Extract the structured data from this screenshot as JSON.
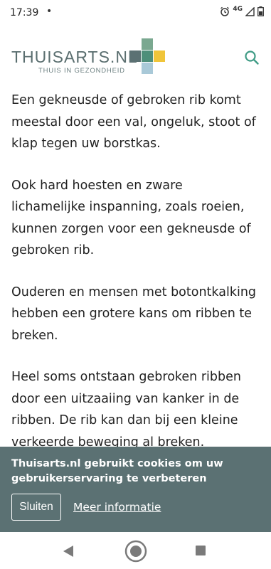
{
  "status_bar": {
    "time": "17:39",
    "dot": "•",
    "network": "4G",
    "icons": [
      "alarm-icon",
      "signal-icon",
      "battery-icon"
    ]
  },
  "header": {
    "logo_title": "THUISARTS.NL",
    "logo_subtitle": "THUIS IN GEZONDHEID",
    "search_icon": "search-icon",
    "colors": {
      "brand_text": "#5a6e6f",
      "cross_top": "#7aa890",
      "cross_left": "#5b7173",
      "cross_center": "#4e8f7a",
      "cross_right": "#f0c53a",
      "cross_bottom": "#a9c9d8",
      "search": "#3f9b85"
    }
  },
  "content": {
    "paragraphs": [
      "Een gekneusde of gebroken rib komt meestal door een val, ongeluk, stoot of klap tegen uw borstkas.",
      "Ook hard hoesten en zware lichamelijke inspanning, zoals roeien, kunnen zorgen voor een gekneusde of gebroken rib.",
      "Ouderen en mensen met botontkalking hebben een grotere kans om ribben te breken.",
      "Heel soms ontstaan gebroken ribben door een uitzaaiing van kanker in de ribben. De rib kan dan bij een kleine verkeerde beweging al breken."
    ]
  },
  "cookie_banner": {
    "message": "Thuisarts.nl gebruikt cookies om uw gebruikerservaring te verbeteren",
    "close_label": "Sluiten",
    "more_label": "Meer informatie",
    "background": "#5b7173"
  },
  "nav_bar": {
    "icons": [
      "back-icon",
      "home-icon",
      "recents-icon"
    ]
  }
}
